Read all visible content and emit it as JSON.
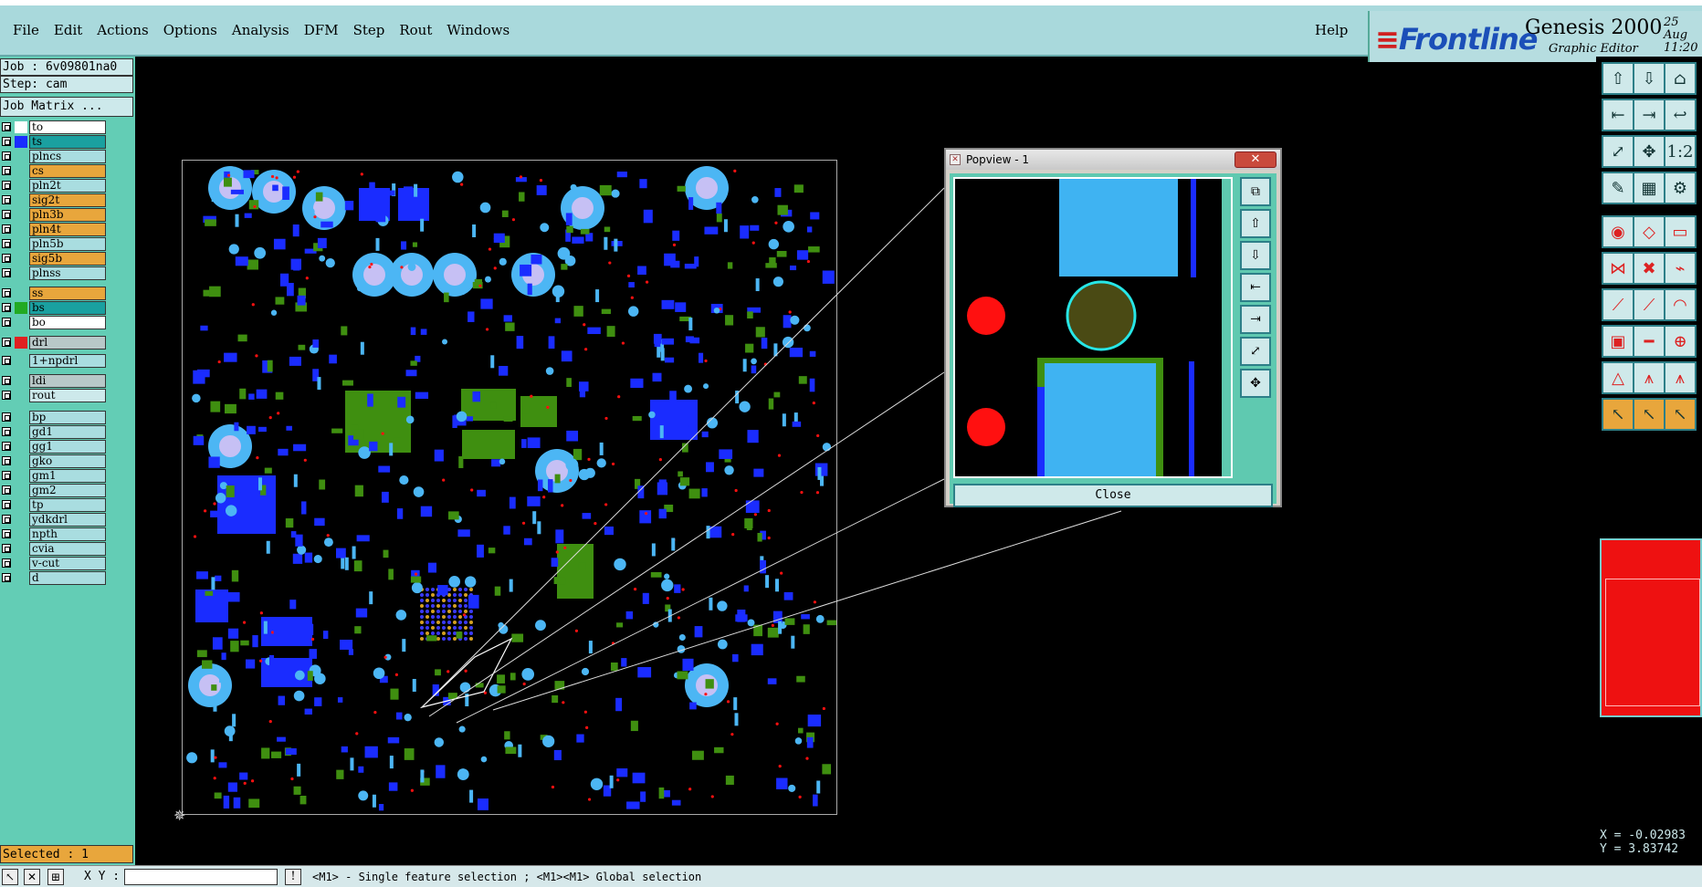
{
  "menu": {
    "items": [
      {
        "label": "File",
        "u": "F"
      },
      {
        "label": "Edit",
        "u": "E"
      },
      {
        "label": "Actions",
        "u": "A"
      },
      {
        "label": "Options",
        "u": "O"
      },
      {
        "label": "Analysis",
        "u": ""
      },
      {
        "label": "DFM",
        "u": ""
      },
      {
        "label": "Step",
        "u": "S"
      },
      {
        "label": "Rout",
        "u": "R"
      },
      {
        "label": "Windows",
        "u": "W"
      }
    ],
    "help": "Help"
  },
  "brand": {
    "logo": "Frontline",
    "product": "Genesis 2000",
    "subtitle": "Graphic Editor",
    "date": "25 Aug",
    "time": "11:20"
  },
  "job": {
    "job_label": "Job : 6v09801na0",
    "step_label": "Step: cam",
    "matrix_button": "Job Matrix ..."
  },
  "layers": [
    {
      "name": "to",
      "color": "#ffffff",
      "swatch": "#ffffff"
    },
    {
      "name": "ts",
      "color": "#1aa0a0",
      "swatch": "#1a2cff"
    },
    {
      "name": "plncs",
      "color": "#a9dde0",
      "swatch": ""
    },
    {
      "name": "cs",
      "color": "#e8a63c",
      "swatch": ""
    },
    {
      "name": "pln2t",
      "color": "#a9dde0",
      "swatch": ""
    },
    {
      "name": "sig2t",
      "color": "#e8a63c",
      "swatch": ""
    },
    {
      "name": "pln3b",
      "color": "#e8a63c",
      "swatch": ""
    },
    {
      "name": "pln4t",
      "color": "#e8a63c",
      "swatch": ""
    },
    {
      "name": "pln5b",
      "color": "#a9dde0",
      "swatch": ""
    },
    {
      "name": "sig5b",
      "color": "#e8a63c",
      "swatch": ""
    },
    {
      "name": "plnss",
      "color": "#a9dde0",
      "swatch": ""
    },
    {
      "name": "ss",
      "color": "#e8a63c",
      "swatch": ""
    },
    {
      "name": "bs",
      "color": "#1aa0a0",
      "swatch": "#22aa22"
    },
    {
      "name": "bo",
      "color": "#ffffff",
      "swatch": ""
    },
    {
      "name": "drl",
      "color": "#b8c8c8",
      "swatch": "#e02020"
    },
    {
      "name": "1+npdrl",
      "color": "#a9dde0",
      "swatch": ""
    },
    {
      "name": "ldi",
      "color": "#b8c8c8",
      "swatch": ""
    },
    {
      "name": "rout",
      "color": "#cde9eb",
      "swatch": ""
    },
    {
      "name": "bp",
      "color": "#a9dde0",
      "swatch": ""
    },
    {
      "name": "gd1",
      "color": "#a9dde0",
      "swatch": ""
    },
    {
      "name": "gg1",
      "color": "#a9dde0",
      "swatch": ""
    },
    {
      "name": "gko",
      "color": "#a9dde0",
      "swatch": ""
    },
    {
      "name": "gm1",
      "color": "#a9dde0",
      "swatch": ""
    },
    {
      "name": "gm2",
      "color": "#a9dde0",
      "swatch": ""
    },
    {
      "name": "tp",
      "color": "#a9dde0",
      "swatch": ""
    },
    {
      "name": "ydkdrl",
      "color": "#a9dde0",
      "swatch": ""
    },
    {
      "name": "npth",
      "color": "#a9dde0",
      "swatch": ""
    },
    {
      "name": "cvia",
      "color": "#a9dde0",
      "swatch": ""
    },
    {
      "name": "v-cut",
      "color": "#a9dde0",
      "swatch": ""
    },
    {
      "name": "d",
      "color": "#a9dde0",
      "swatch": ""
    }
  ],
  "selected": "Selected : 1",
  "status": {
    "xy_label": "X Y :",
    "xy_value": "",
    "message": "<M1> - Single feature selection ; <M1><M1> Global selection"
  },
  "coords": {
    "x": "X = -0.02983",
    "y": "Y = 3.83742"
  },
  "popup": {
    "title": "Popview - 1",
    "close_label": "Close"
  },
  "colors": {
    "pad_blue": "#1a2cff",
    "pad_cyan": "#4cb6f4",
    "copper_green": "#3f8f10",
    "drill_red": "#ff1010",
    "hole_lilac": "#c6c0f4"
  }
}
